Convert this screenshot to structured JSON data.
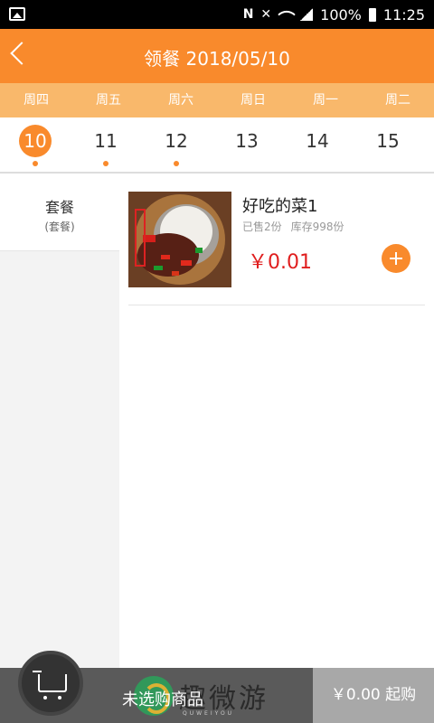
{
  "status_bar": {
    "battery": "100%",
    "time": "11:25"
  },
  "header": {
    "title": "领餐 2018/05/10"
  },
  "weekdays": [
    "周四",
    "周五",
    "周六",
    "周日",
    "周一",
    "周二"
  ],
  "dates": [
    {
      "day": "10",
      "selected": true,
      "has_dot": true
    },
    {
      "day": "11",
      "selected": false,
      "has_dot": true
    },
    {
      "day": "12",
      "selected": false,
      "has_dot": true
    },
    {
      "day": "13",
      "selected": false,
      "has_dot": false
    },
    {
      "day": "14",
      "selected": false,
      "has_dot": false
    },
    {
      "day": "15",
      "selected": false,
      "has_dot": false
    }
  ],
  "category": {
    "name": "套餐",
    "sub": "(套餐)"
  },
  "product": {
    "name": "好吃的菜1",
    "sold": "已售2份",
    "stock": "库存998份",
    "price": "￥0.01"
  },
  "cart": {
    "status": "未选购商品",
    "checkout": "￥0.00 起购"
  },
  "watermark": {
    "text": "趣微游",
    "sub": "QUWEIYOU"
  },
  "colors": {
    "accent": "#f98a2c",
    "weekday_bg": "#f9b86b",
    "price": "#e01e1e"
  }
}
